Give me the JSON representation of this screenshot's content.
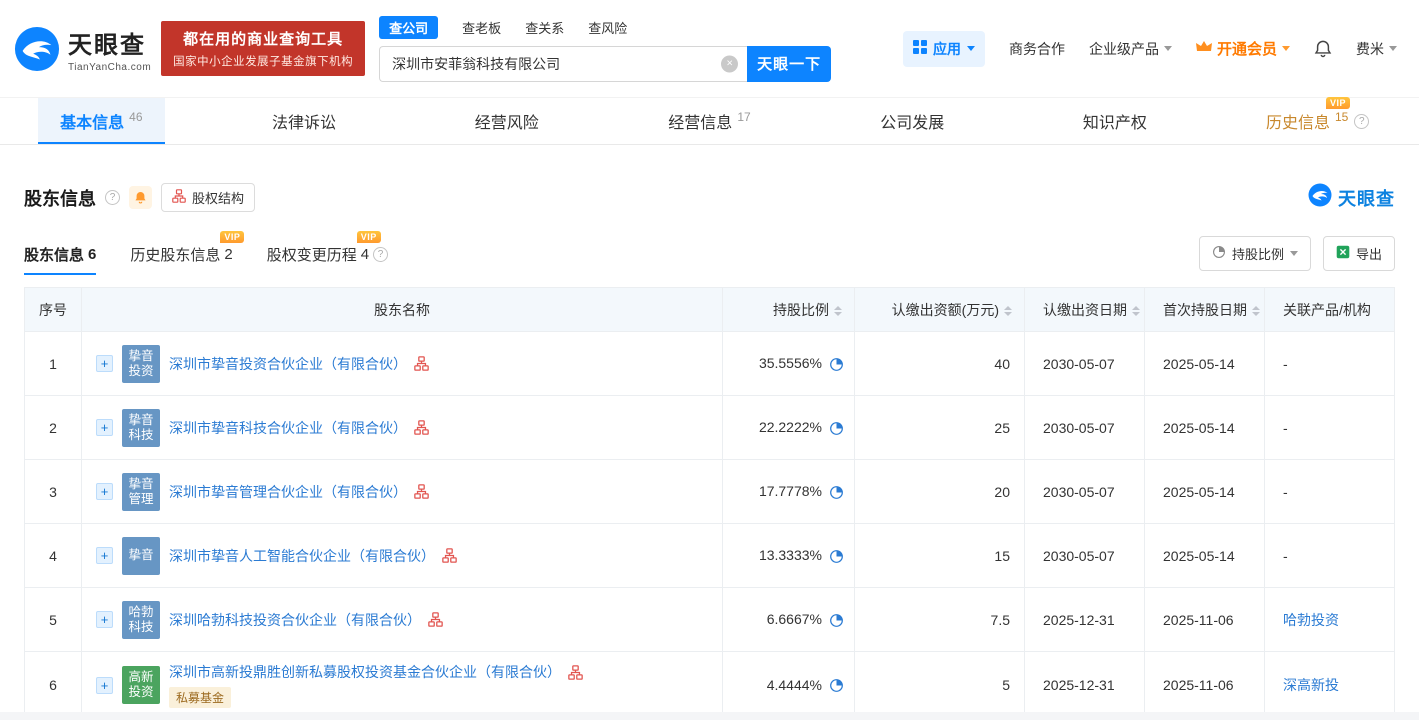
{
  "colors": {
    "brand_blue": "#0d84ff",
    "banner_red": "#c2352a",
    "link_blue": "#2b7bd3",
    "vip_orange": "#ff9a2e",
    "member_orange": "#ff7a00",
    "avatar_blue": "#6796c4",
    "avatar_green": "#4ba45f",
    "table_header_bg": "#f3f8fc"
  },
  "labels": {
    "vip": "VIP",
    "expand": "+",
    "clear": "×",
    "help": "?"
  },
  "header": {
    "logo_title": "天眼查",
    "logo_subtitle": "TianYanCha.com",
    "banner_line1": "都在用的商业查询工具",
    "banner_line2": "国家中小企业发展子基金旗下机构",
    "search_tabs": [
      {
        "label": "查公司",
        "active": true
      },
      {
        "label": "查老板"
      },
      {
        "label": "查关系"
      },
      {
        "label": "查风险"
      }
    ],
    "search_value": "深圳市安菲翁科技有限公司",
    "search_button": "天眼一下",
    "nav_app": "应用",
    "nav_cooperation": "商务合作",
    "nav_enterprise": "企业级产品",
    "nav_member": "开通会员",
    "nav_user": "费米"
  },
  "main_tabs": [
    {
      "label": "基本信息",
      "count": "46",
      "active": true
    },
    {
      "label": "法律诉讼"
    },
    {
      "label": "经营风险"
    },
    {
      "label": "经营信息",
      "count": "17"
    },
    {
      "label": "公司发展"
    },
    {
      "label": "知识产权"
    },
    {
      "label": "历史信息",
      "count": "15",
      "vip": true
    }
  ],
  "section": {
    "title": "股东信息",
    "equity_structure": "股权结构",
    "brand": "天眼查",
    "subtabs": [
      {
        "label": "股东信息",
        "count": "6",
        "active": true
      },
      {
        "label": "历史股东信息",
        "count": "2",
        "vip": true
      },
      {
        "label": "股权变更历程",
        "count": "4",
        "vip": true
      }
    ],
    "ratio_filter": "持股比例",
    "export": "导出"
  },
  "table": {
    "headers": {
      "no": "序号",
      "name": "股东名称",
      "ratio": "持股比例",
      "amount": "认缴出资额(万元)",
      "pay_date": "认缴出资日期",
      "first_date": "首次持股日期",
      "related": "关联产品/机构"
    },
    "rows": [
      {
        "no": "1",
        "avatar": "挚音投资",
        "avatar_color": "#6796c4",
        "name": "深圳市挚音投资合伙企业（有限合伙）",
        "ratio": "35.5556%",
        "amount": "40",
        "pay_date": "2030-05-07",
        "first_date": "2025-05-14",
        "related": "-"
      },
      {
        "no": "2",
        "avatar": "挚音科技",
        "avatar_color": "#6796c4",
        "name": "深圳市挚音科技合伙企业（有限合伙）",
        "ratio": "22.2222%",
        "amount": "25",
        "pay_date": "2030-05-07",
        "first_date": "2025-05-14",
        "related": "-"
      },
      {
        "no": "3",
        "avatar": "挚音管理",
        "avatar_color": "#6796c4",
        "name": "深圳市挚音管理合伙企业（有限合伙）",
        "ratio": "17.7778%",
        "amount": "20",
        "pay_date": "2030-05-07",
        "first_date": "2025-05-14",
        "related": "-"
      },
      {
        "no": "4",
        "avatar": "挚音",
        "avatar_color": "#6796c4",
        "name": "深圳市挚音人工智能合伙企业（有限合伙）",
        "ratio": "13.3333%",
        "amount": "15",
        "pay_date": "2030-05-07",
        "first_date": "2025-05-14",
        "related": "-"
      },
      {
        "no": "5",
        "avatar": "哈勃科技",
        "avatar_color": "#6796c4",
        "name": "深圳哈勃科技投资合伙企业（有限合伙）",
        "ratio": "6.6667%",
        "amount": "7.5",
        "pay_date": "2025-12-31",
        "first_date": "2025-11-06",
        "related": "哈勃投资"
      },
      {
        "no": "6",
        "avatar": "高新投资",
        "avatar_color": "#4ba45f",
        "name": "深圳市高新投鼎胜创新私募股权投资基金合伙企业（有限合伙）",
        "tag": "私募基金",
        "ratio": "4.4444%",
        "amount": "5",
        "pay_date": "2025-12-31",
        "first_date": "2025-11-06",
        "related": "深高新投"
      }
    ]
  }
}
